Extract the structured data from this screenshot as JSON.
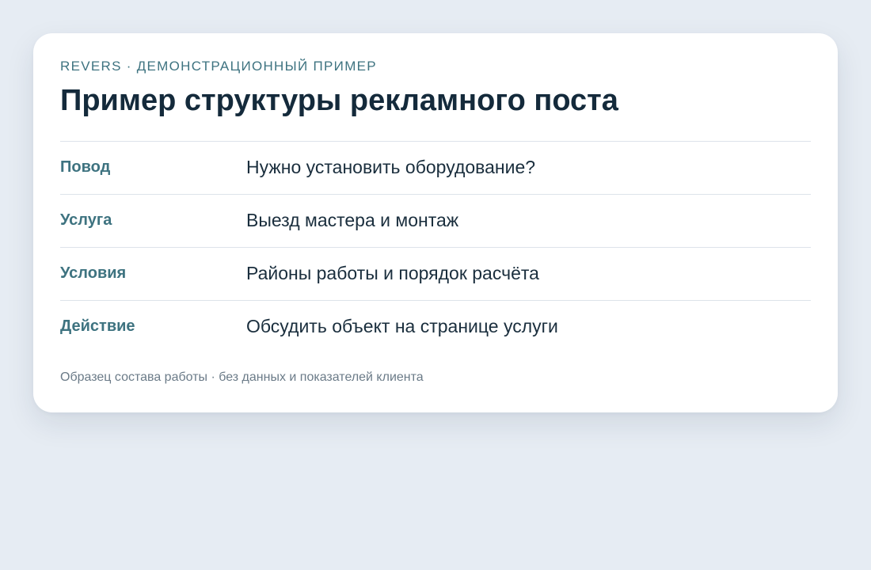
{
  "card": {
    "eyebrow": "REVERS · ДЕМОНСТРАЦИОННЫЙ ПРИМЕР",
    "title": "Пример структуры рекламного поста",
    "rows": [
      {
        "label": "Повод",
        "value": "Нужно установить оборудование?"
      },
      {
        "label": "Услуга",
        "value": "Выезд мастера и монтаж"
      },
      {
        "label": "Условия",
        "value": "Районы работы и порядок расчёта"
      },
      {
        "label": "Действие",
        "value": "Обсудить объект на странице услуги"
      }
    ],
    "footnote": "Образец состава работы · без данных и показателей клиента"
  },
  "colors": {
    "page_background": "#e6ecf3",
    "card_background": "#ffffff",
    "accent": "#3e7380",
    "title_text": "#142a3b",
    "body_text": "#1a2e3d",
    "muted_text": "#6b7b88",
    "divider": "#dde3ea"
  }
}
